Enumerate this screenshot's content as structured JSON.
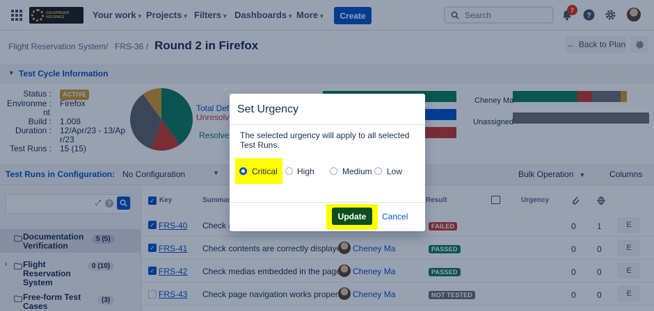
{
  "nav": {
    "logo_text": "GOLDFINGER HOLDINGS",
    "items": [
      "Your work",
      "Projects",
      "Filters",
      "Dashboards",
      "More"
    ],
    "create_label": "Create",
    "search_placeholder": "Search",
    "notification_count": "7"
  },
  "breadcrumb": {
    "items": [
      "Flight Reservation System",
      "FRS-36"
    ],
    "title": "Round 2 in Firefox",
    "back_label": "Back to Plan"
  },
  "test_cycle": {
    "header": "Test Cycle Information",
    "labels": {
      "status": "Status :",
      "environment": "Environme :",
      "environment_wrap": "nt",
      "build": "Build :",
      "duration": "Duration :",
      "test_runs": "Test Runs :"
    },
    "status": "ACTIVE",
    "environment": "Firefox",
    "build": "1.008",
    "duration_line1": "12/Apr/23 - 13/Ap",
    "duration_line2": "r/23",
    "test_runs": "15 (15)",
    "legend_total": "Total Def",
    "legend_unresolved": "Unresolv",
    "legend_resolved": "Resolve",
    "assignees": [
      "Cheney Ma",
      "Unassigned"
    ]
  },
  "pie_data": {
    "type": "pie",
    "values": [
      40,
      15,
      35,
      10
    ],
    "colors": [
      "#0b7a5c",
      "#c9372c",
      "#5e6268",
      "#d49a2a"
    ]
  },
  "assignee_bars": {
    "cheney": [
      {
        "v": 5,
        "c": "#0b7a5c"
      },
      {
        "v": 1.1,
        "c": "#c9372c"
      },
      {
        "v": 2.2,
        "c": "#6b6e75"
      },
      {
        "v": 0.5,
        "c": "#d49a2a"
      }
    ],
    "unassigned": [
      {
        "v": 1,
        "c": "#6b6e75"
      }
    ]
  },
  "runs_bar": {
    "label": "Test Runs in Configuration:",
    "config": "No Configuration",
    "bulk": "Bulk Operation",
    "columns": "Columns"
  },
  "tree": [
    {
      "name": "Documentation Verification",
      "count": "5 (5)"
    },
    {
      "name": "Flight Reservation System",
      "count": "0 (10)"
    },
    {
      "name": "Free-form Test Cases",
      "count": "(3)"
    }
  ],
  "table": {
    "headers": {
      "key": "Key",
      "summary": "Summar",
      "result": "Result",
      "urgency": "Urgency"
    },
    "rows": [
      {
        "key": "FRS-40",
        "summary": "Check a",
        "assignee": "",
        "result": "FAILED",
        "result_color": "#c9372c",
        "c1": "0",
        "c2": "1",
        "checked": true
      },
      {
        "key": "FRS-41",
        "summary": "Check contents are correctly displaye",
        "assignee": "Cheney Ma",
        "result": "PASSED",
        "result_color": "#0b7a5c",
        "c1": "0",
        "c2": "0",
        "checked": true
      },
      {
        "key": "FRS-42",
        "summary": "Check medias embedded in the page",
        "assignee": "Cheney Ma",
        "result": "PASSED",
        "result_color": "#0b7a5c",
        "c1": "0",
        "c2": "0",
        "checked": true
      },
      {
        "key": "FRS-43",
        "summary": "Check page navigation works properly",
        "assignee": "Cheney Ma",
        "result": "NOT TESTED",
        "result_color": "#6b6e75",
        "c1": "0",
        "c2": "0",
        "checked": false
      }
    ],
    "edit_label": "E"
  },
  "modal": {
    "title": "Set Urgency",
    "body": "The selected urgency will apply to all selected Test Runs.",
    "options": [
      "Critical",
      "High",
      "Medium",
      "Low"
    ],
    "selected": "Critical",
    "update_label": "Update",
    "cancel_label": "Cancel"
  }
}
